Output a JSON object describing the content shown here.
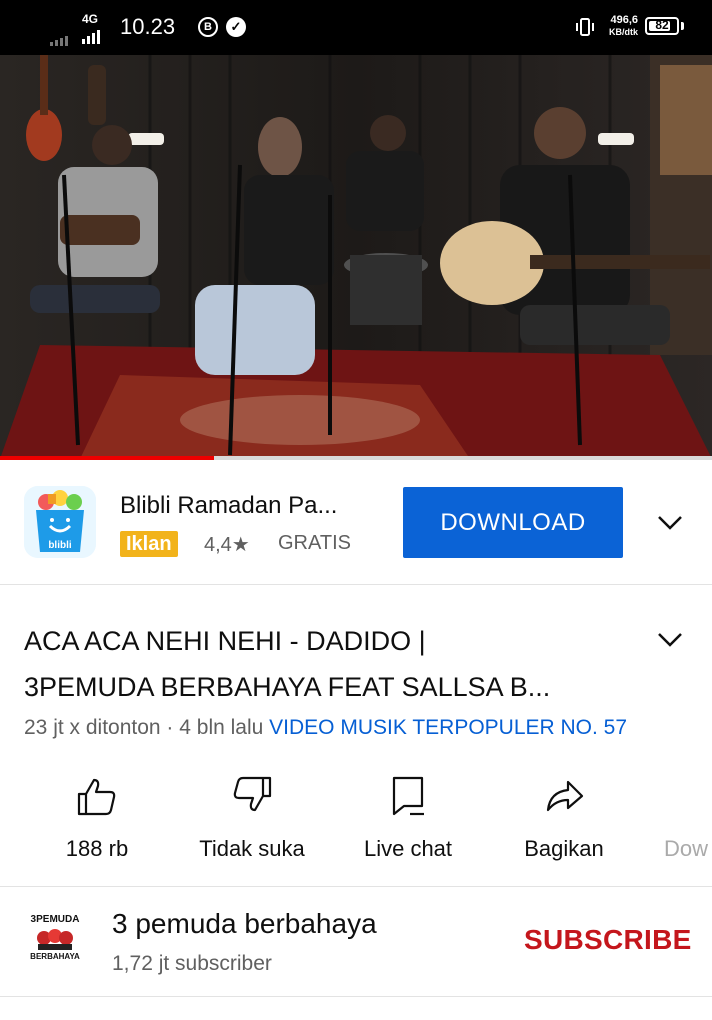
{
  "status_bar": {
    "network": "4G",
    "time": "10.23",
    "b_badge": "B",
    "net_speed_value": "496,6",
    "net_speed_unit": "KB/dtk",
    "battery": "82",
    "battery_level": 0.82
  },
  "video": {
    "progress_fraction": 0.3,
    "progress_color": "#ee0000"
  },
  "ad": {
    "app_icon_text": "blibli",
    "title": "Blibli Ramadan Pa...",
    "badge": "Iklan",
    "rating": "4,4★",
    "price": "GRATIS",
    "download_label": "DOWNLOAD",
    "accent_color": "#0b63d6"
  },
  "video_info": {
    "title_line1": "ACA ACA NEHI NEHI - DADIDO |",
    "title_line2": "3PEMUDA BERBAHAYA FEAT SALLSA B...",
    "views": "23 jt x ditonton · 4 bln lalu",
    "hashtag": "VIDEO MUSIK TERPOPULER NO. 57"
  },
  "actions": {
    "like": "188 rb",
    "dislike": "Tidak suka",
    "live_chat": "Live chat",
    "share": "Bagikan",
    "download": "Dow"
  },
  "channel": {
    "logo_text_top": "3PEMUDA",
    "logo_text_bottom": "BERBAHAYA",
    "name": "3 pemuda berbahaya",
    "subscribers": "1,72 jt subscriber",
    "subscribe_label": "SUBSCRIBE",
    "subscribe_color": "#c4161c"
  }
}
